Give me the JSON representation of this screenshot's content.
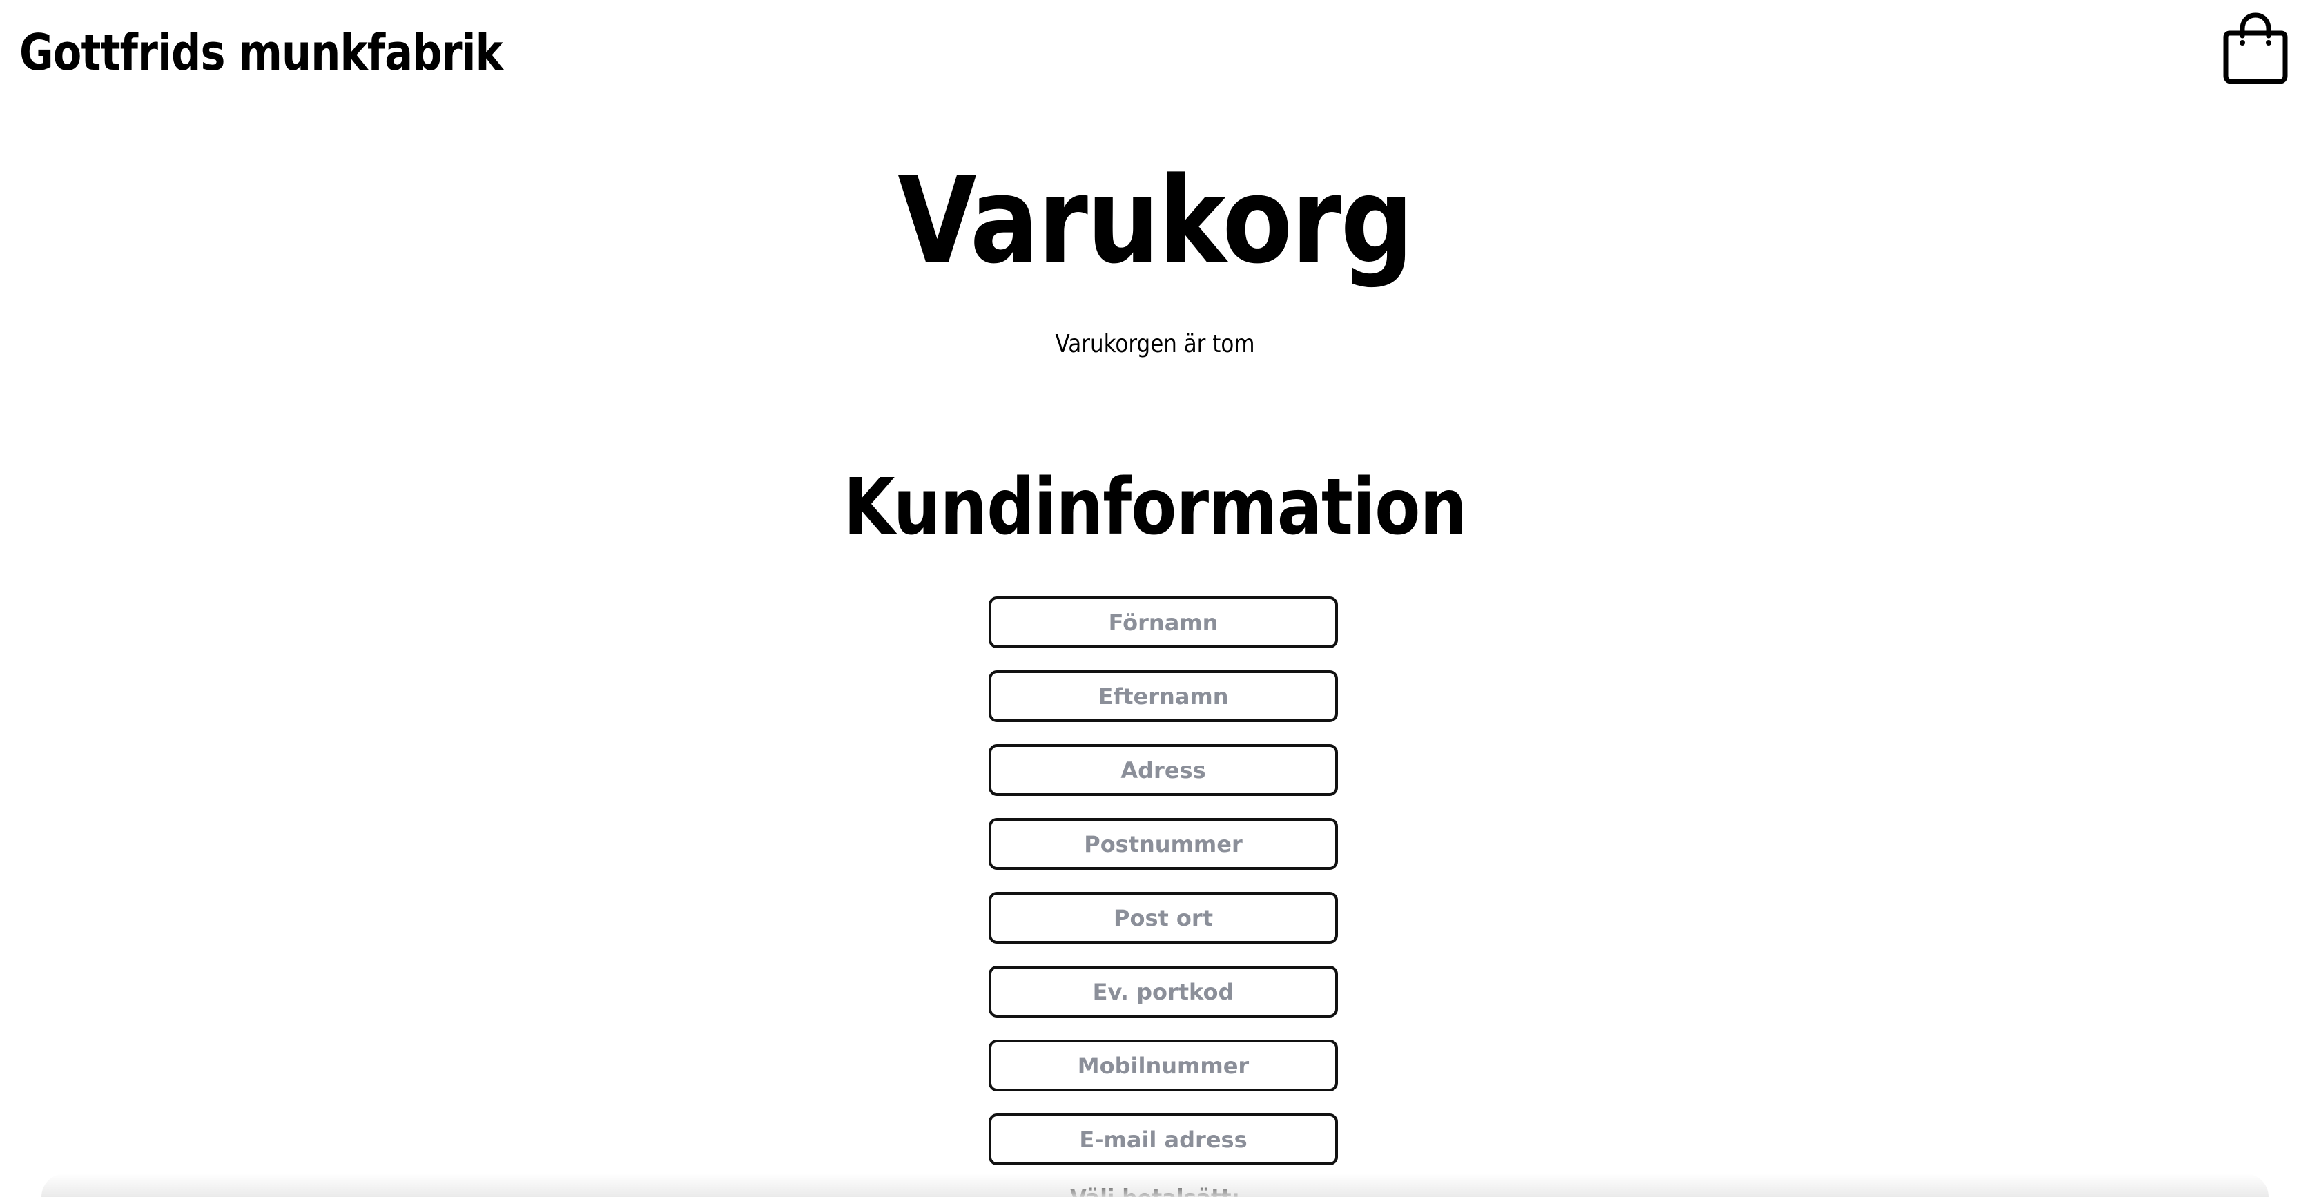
{
  "header": {
    "brand": "Gottfrids munkfabrik",
    "cart_icon": "shopping-bag-icon"
  },
  "main": {
    "title": "Varukorg",
    "empty_message": "Varukorgen är tom",
    "customer_section_title": "Kundinformation",
    "fields": {
      "first_name": {
        "placeholder": "Förnamn",
        "value": ""
      },
      "last_name": {
        "placeholder": "Efternamn",
        "value": ""
      },
      "address": {
        "placeholder": "Adress",
        "value": ""
      },
      "postal_code": {
        "placeholder": "Postnummer",
        "value": ""
      },
      "city": {
        "placeholder": "Post ort",
        "value": ""
      },
      "door_code": {
        "placeholder": "Ev. portkod",
        "value": ""
      },
      "mobile": {
        "placeholder": "Mobilnummer",
        "value": ""
      },
      "email": {
        "placeholder": "E-mail adress",
        "value": ""
      }
    },
    "payment_label": "Välj betalsätt:"
  },
  "colors": {
    "text": "#000000",
    "background": "#ffffff",
    "field_border": "#111111",
    "placeholder": "#8b8f99"
  }
}
